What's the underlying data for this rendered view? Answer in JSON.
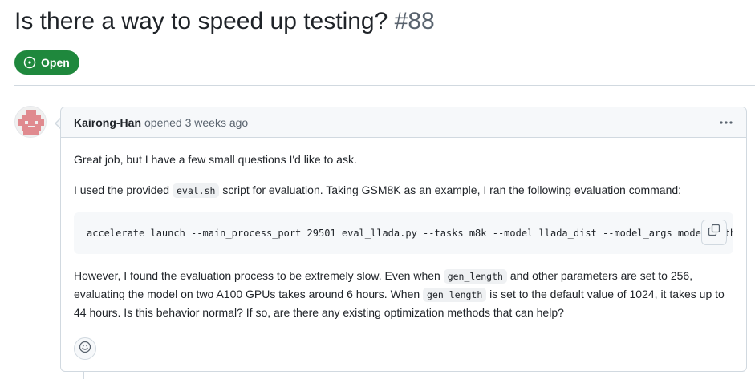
{
  "issue": {
    "title": "Is there a way to speed up testing?",
    "number": "#88",
    "state": "Open",
    "state_icon": "issue-opened-icon",
    "colors": {
      "open_green": "#1f883d",
      "border": "#d1d9e0",
      "header_bg": "#f6f8fa",
      "muted": "#59636e"
    }
  },
  "comment": {
    "author": "Kairong-Han",
    "meta": "opened 3 weeks ago",
    "menu_icon": "kebab-horizontal-icon",
    "body": {
      "p1": "Great job, but I have a few small questions I'd like to ask.",
      "p2_a": "I used the provided ",
      "p2_code": "eval.sh",
      "p2_b": " script for evaluation. Taking GSM8K as an example, I ran the following evaluation command:",
      "code_block": "accelerate launch --main_process_port 29501 eval_llada.py --tasks m8k --model llada_dist --model_args model_path=",
      "copy_icon": "copy-icon",
      "p3_a": "However, I found the evaluation process to be extremely slow. Even when ",
      "p3_code1": "gen_length",
      "p3_b": " and other parameters are set to 256, evaluating the model on two A100 GPUs takes around 6 hours. When ",
      "p3_code2": "gen_length",
      "p3_c": " is set to the default value of 1024, it takes up to 44 hours. Is this behavior normal? If so, are there any existing optimization methods that can help?"
    },
    "reaction_icon": "smiley-icon"
  }
}
